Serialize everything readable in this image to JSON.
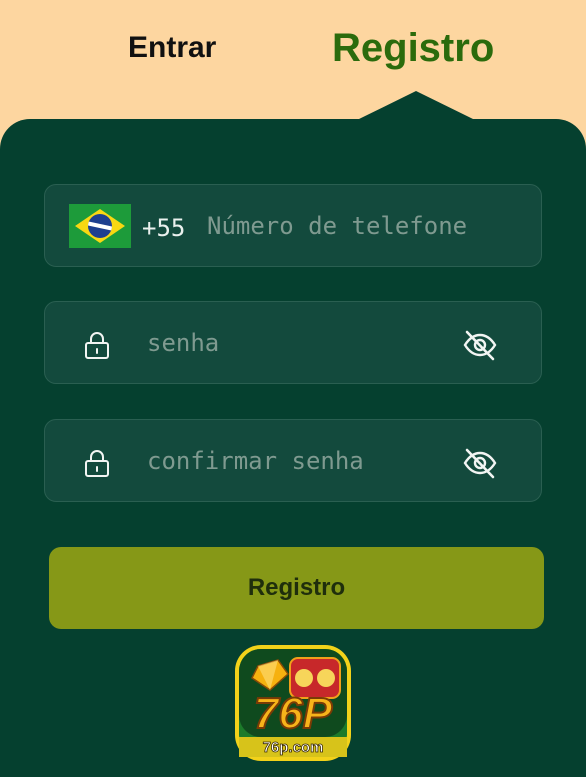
{
  "tabs": {
    "login_label": "Entrar",
    "register_label": "Registro"
  },
  "phone": {
    "country_flag": "brazil-flag-icon",
    "dial_code": "+55",
    "placeholder": "Número de telefone"
  },
  "password": {
    "placeholder": "senha",
    "lock_icon": "lock-icon",
    "visibility_icon": "eye-off-icon"
  },
  "confirm_password": {
    "placeholder": "confirmar senha",
    "lock_icon": "lock-icon",
    "visibility_icon": "eye-off-icon"
  },
  "submit": {
    "label": "Registro"
  },
  "logo": {
    "text": "76P",
    "domain": "76p.com"
  },
  "colors": {
    "page_background": "#fdd6a0",
    "panel": "#05402f",
    "field": "#134a3d",
    "active_tab": "#2b6b0c",
    "button": "#869817"
  }
}
